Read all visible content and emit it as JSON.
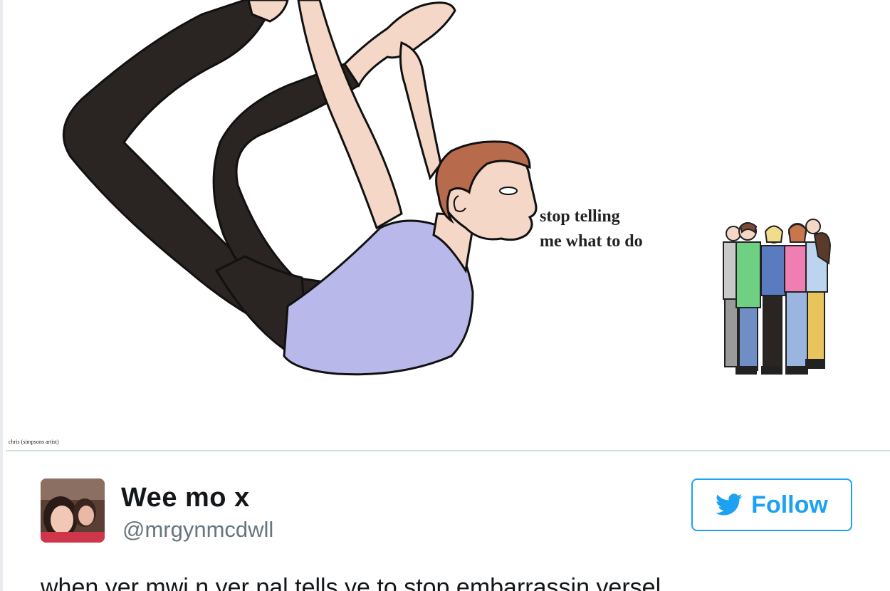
{
  "meme": {
    "speech_text_line1": "stop telling",
    "speech_text_line2": "me what to do",
    "credit": "chris (simpsons artist)"
  },
  "tweet": {
    "display_name": "Wee mo x",
    "handle": "@mrgynmcdwll",
    "follow_label": "Follow",
    "text": "when yer mwi n yer pal tells ye to stop embarrassin yersel"
  },
  "colors": {
    "accent": "#1da1f2",
    "name_text": "#14171a",
    "handle_text": "#66757f",
    "shirt": "#b9b8ea",
    "leggings": "#2a2423",
    "skin": "#f4d7c6",
    "hair": "#b86b4c"
  },
  "icons": {
    "follow_icon": "twitter-bird-icon"
  }
}
